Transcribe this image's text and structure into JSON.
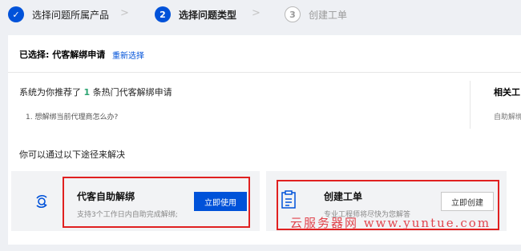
{
  "steps": [
    {
      "number": "✓",
      "label": "选择问题所属产品",
      "state": "done"
    },
    {
      "number": "2",
      "label": "选择问题类型",
      "state": "active"
    },
    {
      "number": "3",
      "label": "创建工单",
      "state": "todo"
    }
  ],
  "selected": {
    "text": "已选择: 代客解绑申请",
    "reselect_label": "重新选择"
  },
  "recommend": {
    "prefix": "系统为你推荐了",
    "count": "1",
    "suffix": "条热门代客解绑申请",
    "items": [
      "1. 想解绑当前代理商怎么办?"
    ]
  },
  "related": {
    "title": "相关工",
    "subtitle": "自助解绑"
  },
  "paths_title": "你可以通过以下途径来解决",
  "cards": [
    {
      "title": "代客自助解绑",
      "desc": "支持3个工作日内自助完成解绑;",
      "button": "立即使用",
      "icon": "search-refresh-icon"
    },
    {
      "title": "创建工单",
      "desc": "专业工程师将尽快为您解答",
      "button": "立即创建",
      "icon": "ticket-icon"
    }
  ],
  "watermark": "云服务器网 www.yuntue.com",
  "colors": {
    "primary": "#0052d9",
    "highlight": "#e02020",
    "count": "#2ba471",
    "watermark": "#e0323b"
  }
}
